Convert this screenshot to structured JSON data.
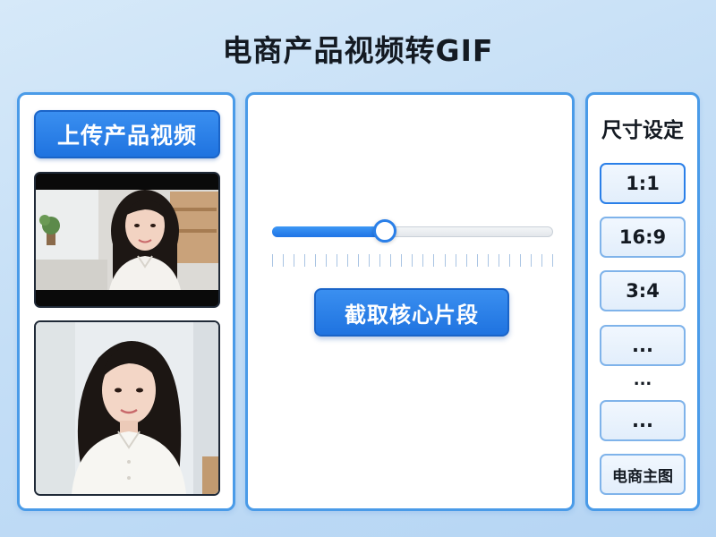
{
  "page_title": "电商产品视频转GIF",
  "left_panel": {
    "upload_button": "上传产品视频",
    "thumbnails": [
      {
        "kind": "video-frame-landscape"
      },
      {
        "kind": "video-frame-portrait"
      }
    ]
  },
  "center_panel": {
    "slider": {
      "value": 0.4
    },
    "clip_button": "截取核心片段"
  },
  "right_panel": {
    "title": "尺寸设定",
    "options": [
      "1:1",
      "16:9",
      "3:4",
      "...",
      "...",
      "电商主图"
    ],
    "separator": "...",
    "selected_index": 0
  },
  "colors": {
    "accent": "#1f73e0",
    "panel_border": "#4a9be8",
    "background": "#c4def6"
  }
}
